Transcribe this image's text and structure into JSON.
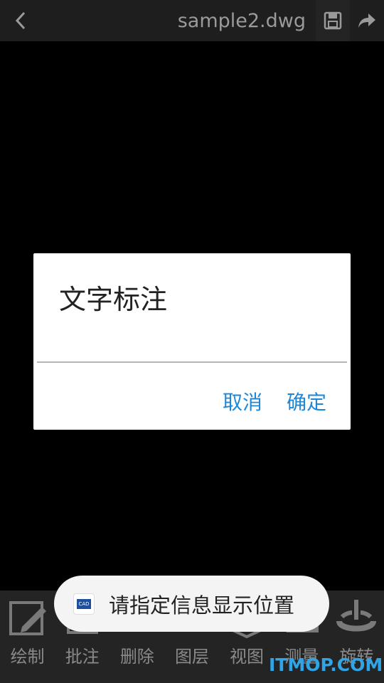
{
  "header": {
    "title": "sample2.dwg",
    "back_icon": "chevron-left-icon",
    "save_icon": "save-icon",
    "share_icon": "share-icon"
  },
  "dialog": {
    "title": "文字标注",
    "input_value": "",
    "cancel_label": "取消",
    "confirm_label": "确定",
    "accent_color": "#1e88d6"
  },
  "toolbar": {
    "items": [
      {
        "label": "绘制",
        "icon": "pencil-icon"
      },
      {
        "label": "批注",
        "icon": "annotate-icon"
      },
      {
        "label": "删除",
        "icon": "delete-icon"
      },
      {
        "label": "图层",
        "icon": "layers-icon"
      },
      {
        "label": "视图",
        "icon": "view-icon"
      },
      {
        "label": "测量",
        "icon": "measure-icon"
      },
      {
        "label": "旋转",
        "icon": "rotate-icon"
      }
    ]
  },
  "toast": {
    "message": "请指定信息显示位置",
    "icon": "cad-app-icon",
    "icon_text": "CAD"
  },
  "watermark": "ITMOP.COM"
}
